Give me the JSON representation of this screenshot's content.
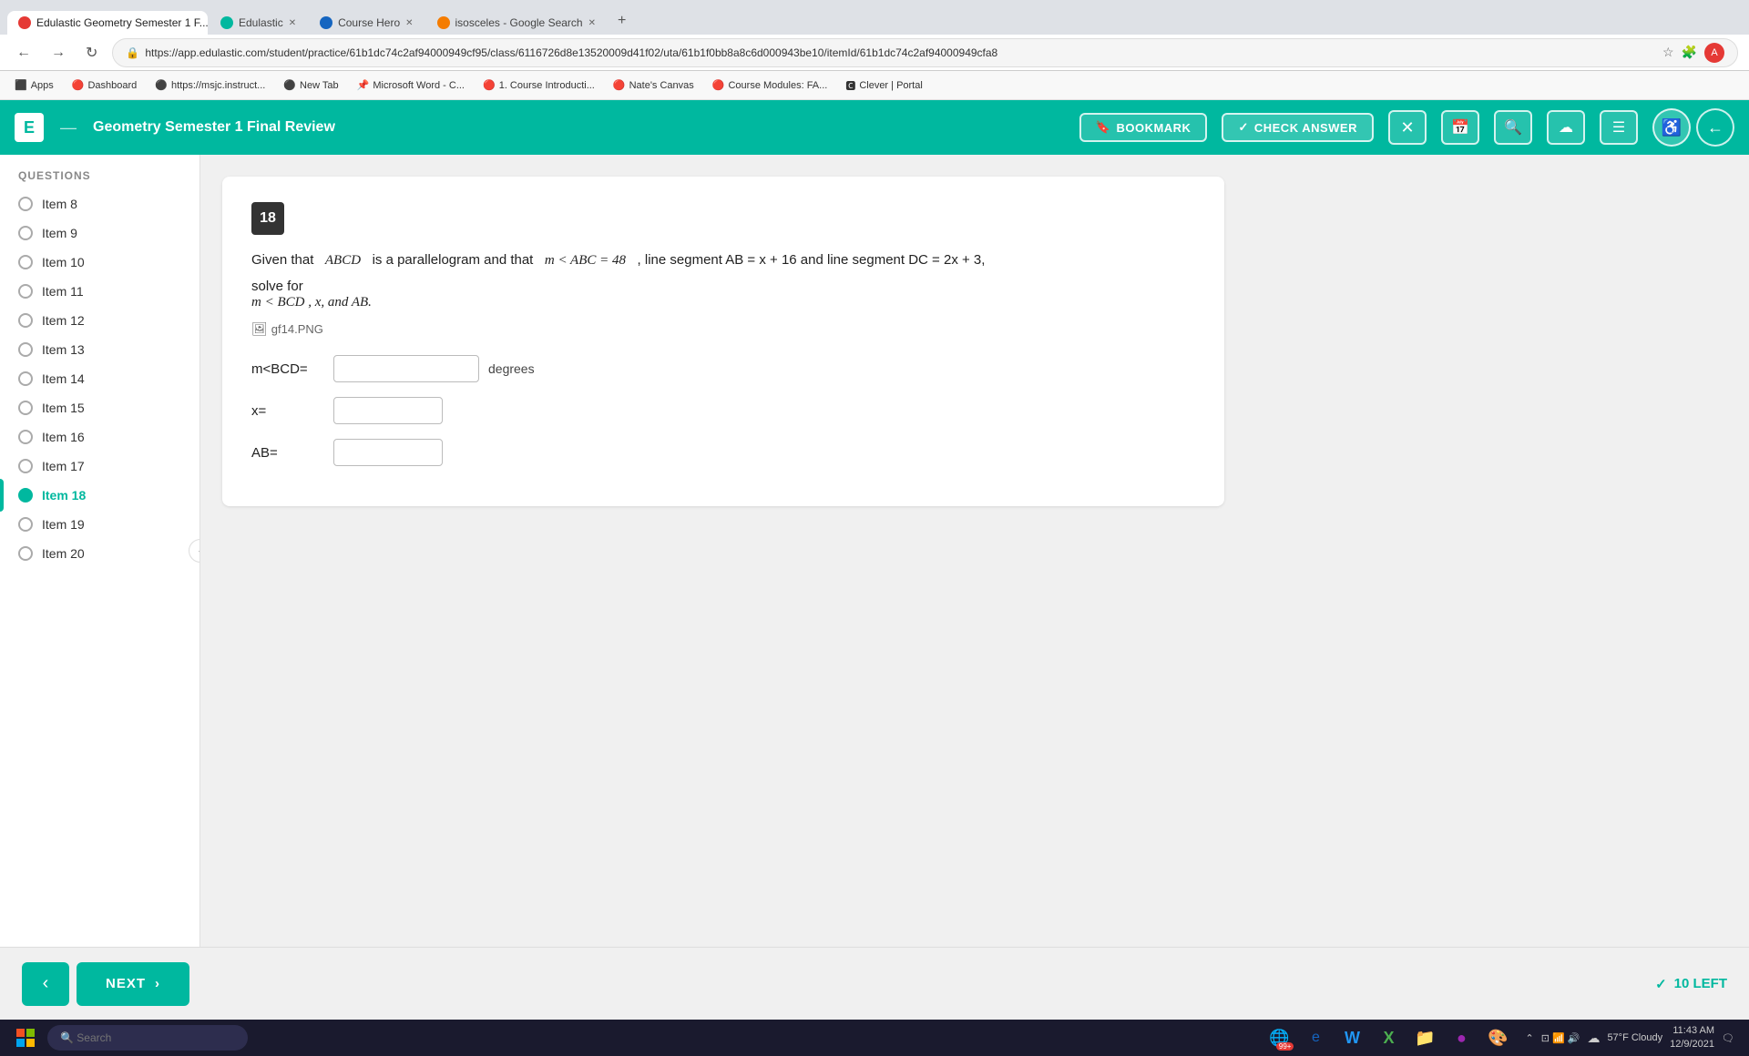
{
  "browser": {
    "tabs": [
      {
        "id": "tab1",
        "label": "Edulastic Geometry Semester 1 F...",
        "icon_color": "#e53935",
        "active": true
      },
      {
        "id": "tab2",
        "label": "Edulastic",
        "icon_color": "#00b89f",
        "active": false
      },
      {
        "id": "tab3",
        "label": "Course Hero",
        "icon_color": "#1565c0",
        "active": false
      },
      {
        "id": "tab4",
        "label": "isosceles - Google Search",
        "icon_color": "#f57c00",
        "active": false
      }
    ],
    "url": "https://app.edulastic.com/student/practice/61b1dc74c2af94000949cf95/class/6116726d8e13520009d41f02/uta/61b1f0bb8a8c6d000943be10/itemId/61b1dc74c2af94000949cfa8",
    "bookmarks": [
      {
        "label": "Apps"
      },
      {
        "label": "Dashboard"
      },
      {
        "label": "https://msjc.instruct..."
      },
      {
        "label": "New Tab"
      },
      {
        "label": "Microsoft Word - C..."
      },
      {
        "label": "1. Course Introducti..."
      },
      {
        "label": "Nate's Canvas"
      },
      {
        "label": "Course Modules: FA..."
      },
      {
        "label": "Clever | Portal"
      }
    ]
  },
  "header": {
    "logo_letter": "E",
    "title": "Geometry Semester 1 Final Review",
    "bookmark_label": "BOOKMARK",
    "check_answer_label": "CHECK ANSWER",
    "buttons": [
      "calendar",
      "search",
      "upload",
      "menu"
    ]
  },
  "sidebar": {
    "title": "QUESTIONS",
    "items": [
      {
        "id": "item8",
        "label": "Item 8",
        "active": false,
        "filled": false
      },
      {
        "id": "item9",
        "label": "Item 9",
        "active": false,
        "filled": false
      },
      {
        "id": "item10",
        "label": "Item 10",
        "active": false,
        "filled": false
      },
      {
        "id": "item11",
        "label": "Item 11",
        "active": false,
        "filled": false
      },
      {
        "id": "item12",
        "label": "Item 12",
        "active": false,
        "filled": false
      },
      {
        "id": "item13",
        "label": "Item 13",
        "active": false,
        "filled": false
      },
      {
        "id": "item14",
        "label": "Item 14",
        "active": false,
        "filled": false
      },
      {
        "id": "item15",
        "label": "Item 15",
        "active": false,
        "filled": false
      },
      {
        "id": "item16",
        "label": "Item 16",
        "active": false,
        "filled": false
      },
      {
        "id": "item17",
        "label": "Item 17",
        "active": false,
        "filled": false
      },
      {
        "id": "item18",
        "label": "Item 18",
        "active": true,
        "filled": true
      },
      {
        "id": "item19",
        "label": "Item 19",
        "active": false,
        "filled": false
      },
      {
        "id": "item20",
        "label": "Item 20",
        "active": false,
        "filled": false
      }
    ]
  },
  "question": {
    "number": "18",
    "intro": "Given that",
    "abcd_label": "ABCD",
    "is_parallelogram": "is a parallelogram and that",
    "angle_abc": "m < ABC = 48",
    "rest_of_intro": ", line segment AB = x + 16 and line segment DC = 2x + 3,",
    "solve_for": "solve for",
    "solve_vars": "m < BCD , x, and AB.",
    "image_label": "gf14.PNG",
    "fields": [
      {
        "id": "mbcd",
        "label": "m<BCD=",
        "unit": "degrees",
        "placeholder": ""
      },
      {
        "id": "x",
        "label": "x=",
        "unit": "",
        "placeholder": ""
      },
      {
        "id": "ab",
        "label": "AB=",
        "unit": "",
        "placeholder": ""
      }
    ]
  },
  "navigation": {
    "prev_label": "‹",
    "next_label": "NEXT",
    "remaining_count": "10 LEFT"
  },
  "taskbar": {
    "apps": [
      {
        "icon": "🪟",
        "name": "windows-start"
      },
      {
        "icon": "🔍",
        "name": "search"
      },
      {
        "icon": "🗂",
        "name": "task-view"
      },
      {
        "icon": "🟩",
        "name": "edge-icon",
        "badge": "99+"
      },
      {
        "icon": "📘",
        "name": "ie-icon"
      },
      {
        "icon": "📝",
        "name": "word-icon"
      },
      {
        "icon": "📗",
        "name": "excel-icon"
      },
      {
        "icon": "📁",
        "name": "files-icon"
      },
      {
        "icon": "🟣",
        "name": "app1"
      },
      {
        "icon": "🎨",
        "name": "app2"
      }
    ],
    "weather": "☁",
    "temperature": "57°F  Cloudy",
    "time": "11:43 AM",
    "date": "12/9/2021"
  }
}
